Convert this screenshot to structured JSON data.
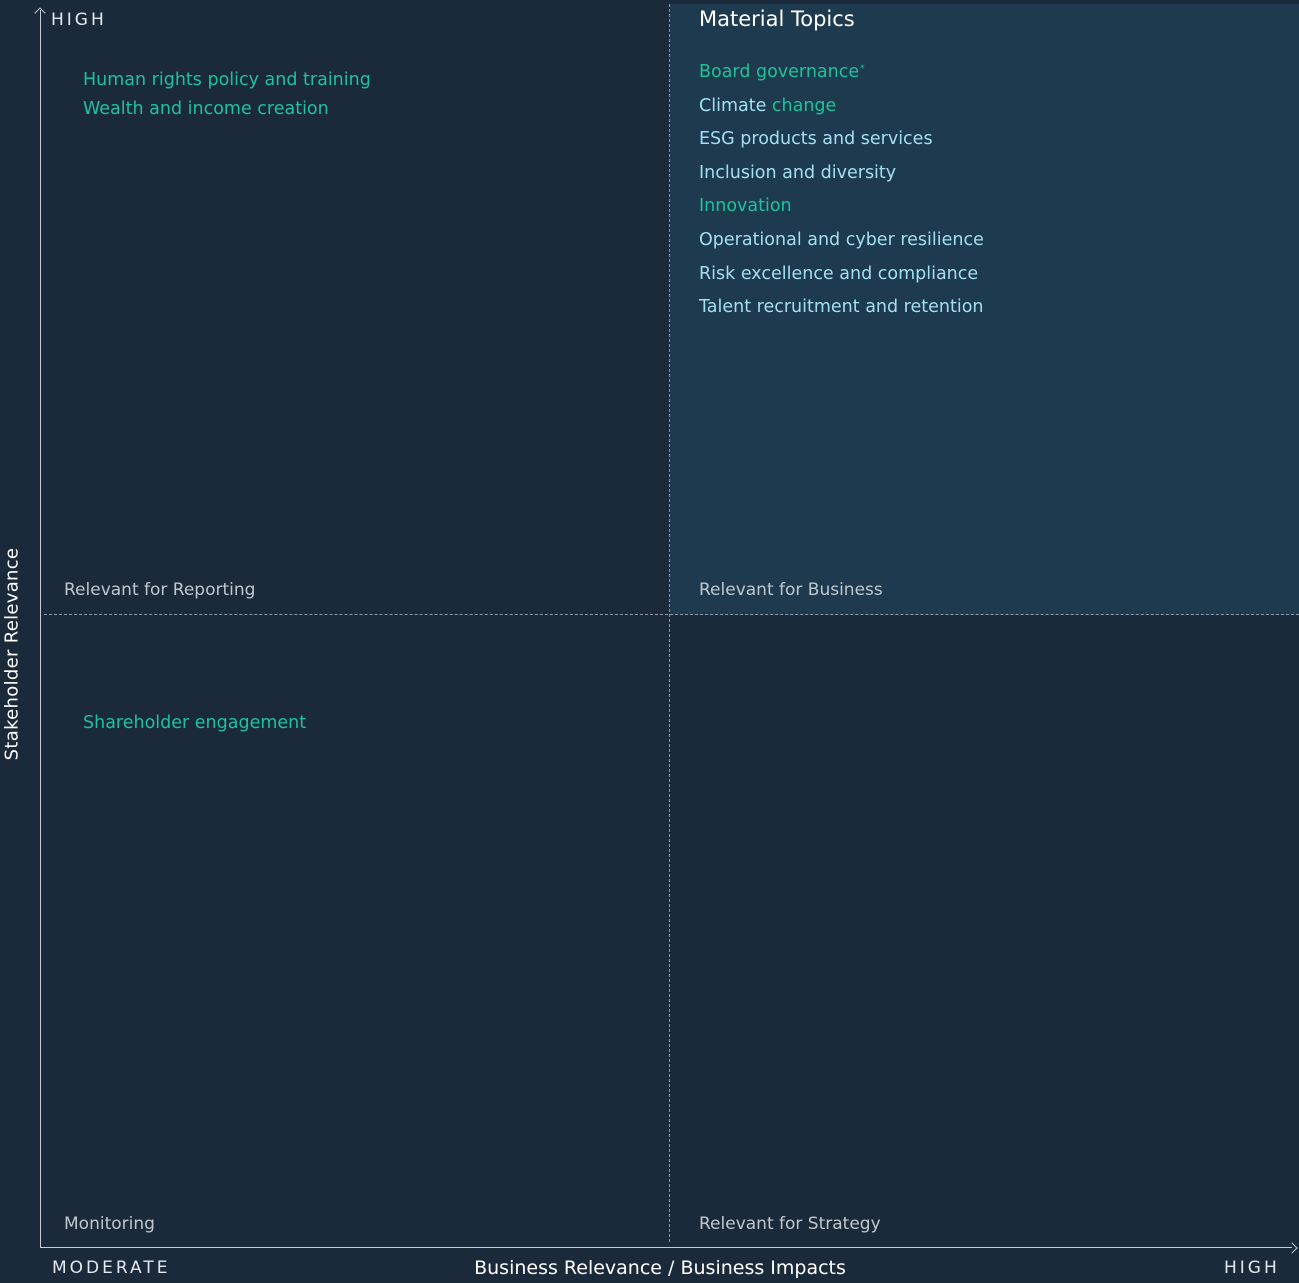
{
  "axes": {
    "y_title": "Stakeholder Relevance",
    "x_title": "Business Relevance / Business Impacts",
    "y_high": "HIGH",
    "x_low": "MODERATE",
    "x_high": "HIGH"
  },
  "quadrants": {
    "top_left": {
      "label": "Relevant for Reporting",
      "topics": [
        "Human rights policy and training",
        "Wealth and income creation"
      ]
    },
    "top_right": {
      "title": "Material Topics",
      "label": "Relevant for Business",
      "topics": [
        "Board governance",
        "Climate change",
        "ESG products and services",
        "Inclusion and diversity",
        "Innovation",
        "Operational and cyber resilience",
        "Risk excellence and compliance",
        "Talent recruitment and retention"
      ],
      "board_governance_mark": "*",
      "climate_change_parts": [
        "Climate ",
        "change"
      ]
    },
    "bottom_left": {
      "label": "Monitoring",
      "topics": [
        "Shareholder engagement"
      ]
    },
    "bottom_right": {
      "label": "Relevant for Strategy"
    }
  },
  "colors": {
    "background": "#1b2a3b",
    "material_quadrant": "#1d3a4e",
    "topic_green": "#1fc29a",
    "topic_light_blue": "#a4dff0",
    "quadrant_label": "#c0c7cd"
  }
}
